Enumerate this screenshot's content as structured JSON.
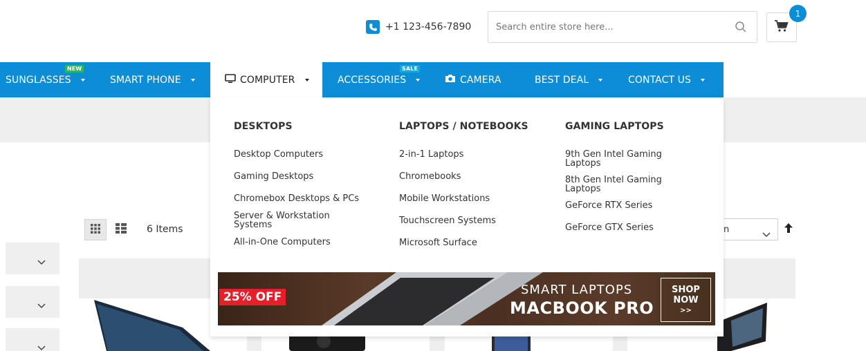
{
  "header": {
    "phone": "+1 123-456-7890",
    "search_placeholder": "Search entire store here...",
    "cart_count": "1"
  },
  "nav": {
    "items": [
      {
        "label": "SUNGLASSES",
        "tag": "NEW"
      },
      {
        "label": "SMART PHONE"
      },
      {
        "label": "COMPUTER"
      },
      {
        "label": "ACCESSORIES",
        "tag": "SALE"
      },
      {
        "label": "CAMERA"
      },
      {
        "label": "BEST DEAL"
      },
      {
        "label": "CONTACT US"
      }
    ]
  },
  "mega_menu": {
    "columns": [
      {
        "title": "DESKTOPS",
        "links": [
          "Desktop Computers",
          "Gaming Desktops",
          "Chromebox Desktops & PCs",
          "Server & Workstation Systems",
          "All-in-One Computers"
        ]
      },
      {
        "title": "LAPTOPS / NOTEBOOKS",
        "links": [
          "2-in-1 Laptops",
          "Chromebooks",
          "Mobile Workstations",
          "Touchscreen Systems",
          "Microsoft Surface"
        ]
      },
      {
        "title": "GAMING LAPTOPS",
        "links": [
          "9th Gen Intel Gaming Laptops",
          "8th Gen Intel Gaming Laptops",
          "GeForce RTX Series",
          "GeForce GTX Series"
        ]
      }
    ],
    "banner": {
      "discount": "25% OFF",
      "line1": "SMART LAPTOPS",
      "line2": "MACBOOK PRO",
      "shop1": "SHOP",
      "shop2": "NOW",
      "shop3": ">>"
    }
  },
  "toolbar": {
    "items_count": "6 Items",
    "sort_visible": "n"
  },
  "colors": {
    "primary": "#0d8dd6",
    "band": "#efefef",
    "sale_badge": "#e5202a"
  }
}
